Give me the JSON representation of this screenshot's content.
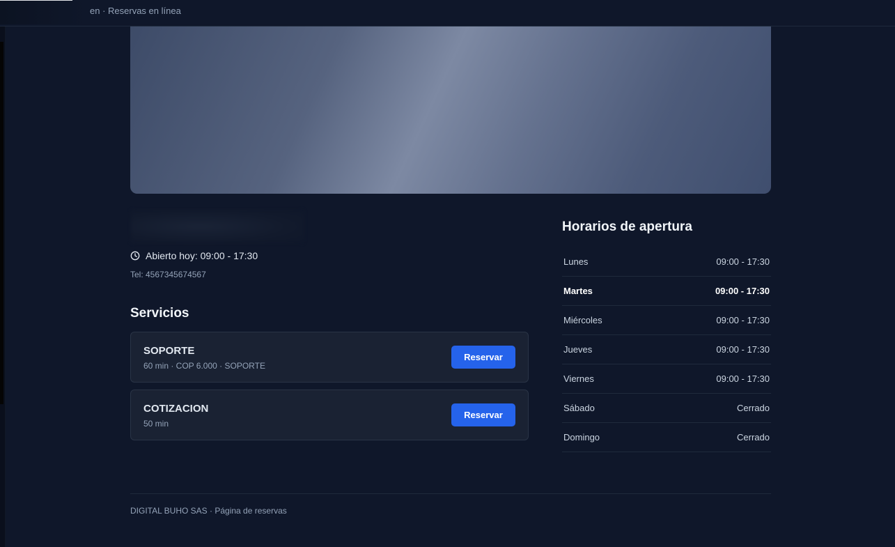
{
  "header": {
    "breadcrumb": "en · Reservas en línea"
  },
  "business": {
    "open_today": "Abierto hoy: 09:00 - 17:30",
    "phone": "Tel: 4567345674567"
  },
  "services": {
    "title": "Servicios",
    "items": [
      {
        "name": "SOPORTE",
        "meta": "60 min · COP 6.000 · SOPORTE",
        "button": "Reservar"
      },
      {
        "name": "COTIZACION",
        "meta": "50 min",
        "button": "Reservar"
      }
    ]
  },
  "hours": {
    "title": "Horarios de apertura",
    "days": [
      {
        "day": "Lunes",
        "time": "09:00 - 17:30"
      },
      {
        "day": "Martes",
        "time": "09:00 - 17:30"
      },
      {
        "day": "Miércoles",
        "time": "09:00 - 17:30"
      },
      {
        "day": "Jueves",
        "time": "09:00 - 17:30"
      },
      {
        "day": "Viernes",
        "time": "09:00 - 17:30"
      },
      {
        "day": "Sábado",
        "time": "Cerrado"
      },
      {
        "day": "Domingo",
        "time": "Cerrado"
      }
    ]
  },
  "footer": {
    "text": "DIGITAL BUHO SAS · Página de reservas"
  },
  "colors": {
    "background": "#0f172a",
    "accent": "#2563eb",
    "card": "#1a2233"
  },
  "icons": {
    "clock": "clock-icon"
  }
}
